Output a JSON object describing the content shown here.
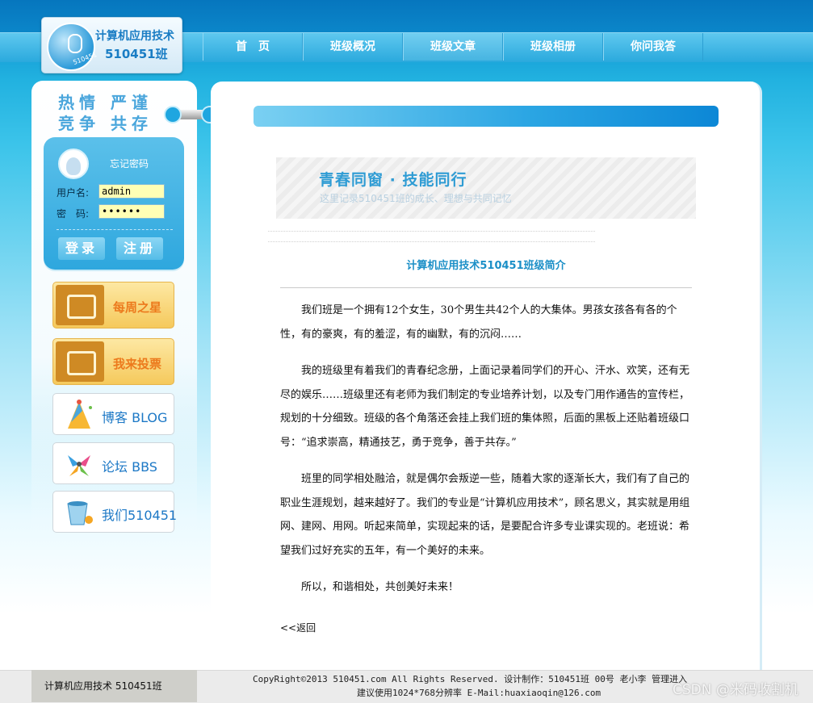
{
  "logo": {
    "title": "计算机应用技术",
    "subtitle": "510451班",
    "badge": "510451"
  },
  "nav": [
    "首　页",
    "班级概况",
    "班级文章",
    "班级相册",
    "你问我答"
  ],
  "sidebar": {
    "slogan_line1": "热情 严谨",
    "slogan_line2": "竞争 共存",
    "login": {
      "forgot_link": "忘记密码",
      "username_label": "用户名:",
      "username_value": "admin",
      "password_label": "密　码:",
      "password_value": "••••••",
      "login_button": "登录",
      "register_button": "注册"
    },
    "tiles": {
      "weekly_star": "每周之星",
      "vote": "我来投票",
      "blog": "博客 BLOG",
      "bbs": "论坛 BBS",
      "about": "我们510451"
    }
  },
  "banner": {
    "title": "青春同窗 · 技能同行",
    "subtitle": "这里记录510451班的成长、理想与共同记忆"
  },
  "article": {
    "title": "计算机应用技术510451班级简介",
    "paragraphs": [
      "我们班是一个拥有12个女生，30个男生共42个人的大集体。男孩女孩各有各的个性，有的豪爽，有的羞涩，有的幽默，有的沉闷……",
      "我的班级里有着我们的青春纪念册，上面记录着同学们的开心、汗水、欢笑，还有无尽的娱乐……班级里还有老师为我们制定的专业培养计划，以及专门用作通告的宣传栏，规划的十分细致。班级的各个角落还会挂上我们班的集体照，后面的黑板上还贴着班级口号：“追求崇高，精通技艺，勇于竞争，善于共存。”",
      "班里的同学相处融洽，就是偶尔会叛逆一些，随着大家的逐渐长大，我们有了自己的职业生涯规划，越来越好了。我们的专业是“计算机应用技术”，顾名思义，其实就是用组网、建网、用网。听起来简单，实现起来的话，是要配合许多专业课实现的。老班说：希望我们过好充实的五年，有一个美好的未来。",
      "所以，和谐相处，共创美好未来！"
    ],
    "back_link": "<<返回"
  },
  "footer": {
    "left": "计算机应用技术 510451班",
    "line1": "CopyRight©2013 510451.com All Rights Reserved. 设计制作：510451班 00号 老小李 管理进入",
    "line2": "建议使用1024*768分辨率 E-Mail:huaxiaoqin@126.com",
    "watermark": "CSDN @米码收割机"
  },
  "colors": {
    "accent": "#1b8fc7",
    "nav_bg": "#2aa9dd",
    "gold": "#f5c95c"
  }
}
